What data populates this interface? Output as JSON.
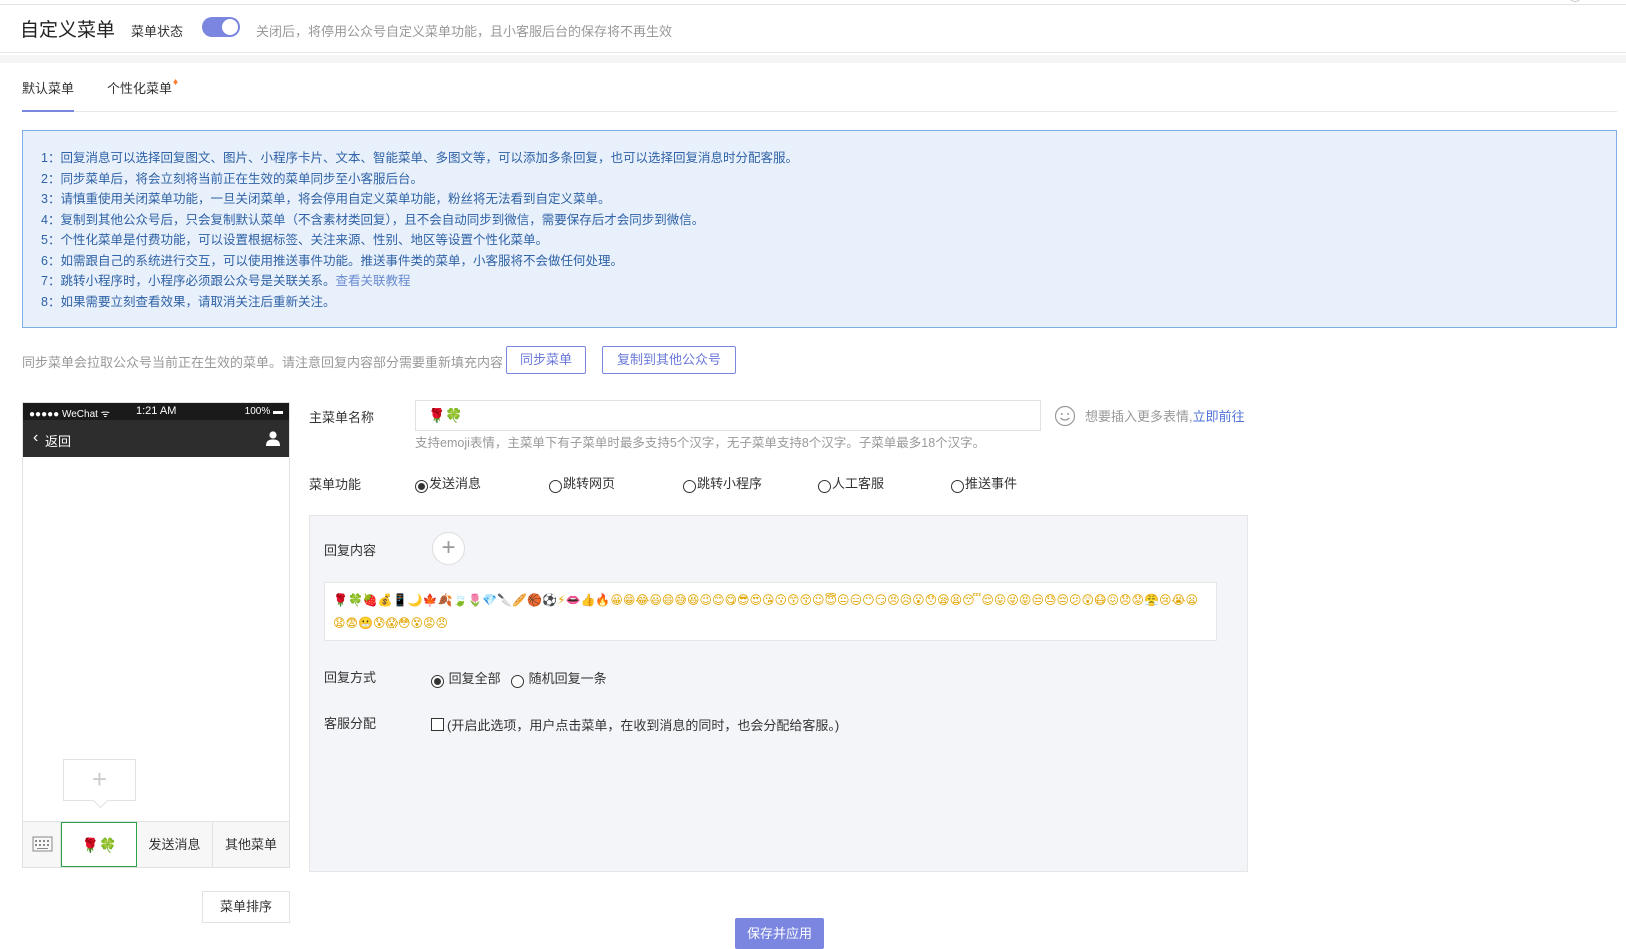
{
  "header": {
    "title": "自定义菜单",
    "status_label": "菜单状态",
    "toggle_on": true,
    "status_hint": "关闭后，将停用公众号自定义菜单功能，且小客服后台的保存将不再生效"
  },
  "tabs": [
    {
      "label": "默认菜单",
      "active": true
    },
    {
      "label": "个性化菜单",
      "active": false,
      "icon": "vip-diamond-icon"
    }
  ],
  "notice": {
    "lines": [
      "1：回复消息可以选择回复图文、图片、小程序卡片、文本、智能菜单、多图文等，可以添加多条回复，也可以选择回复消息时分配客服。",
      "2：同步菜单后，将会立刻将当前正在生效的菜单同步至小客服后台。",
      "3：请慎重使用关闭菜单功能，一旦关闭菜单，将会停用自定义菜单功能，粉丝将无法看到自定义菜单。",
      "4：复制到其他公众号后，只会复制默认菜单（不含素材类回复），且不会自动同步到微信，需要保存后才会同步到微信。",
      "5：个性化菜单是付费功能，可以设置根据标签、关注来源、性别、地区等设置个性化菜单。",
      "6：如需跟自己的系统进行交互，可以使用推送事件功能。推送事件类的菜单，小客服将不会做任何处理。",
      "7：跳转小程序时，小程序必须跟公众号是关联关系。",
      "8：如果需要立刻查看效果，请取消关注后重新关注。"
    ],
    "line7_link": "查看关联教程"
  },
  "sync": {
    "hint": "同步菜单会拉取公众号当前正在生效的菜单。请注意回复内容部分需要重新填充内容",
    "sync_button": "同步菜单",
    "copy_button": "复制到其他公众号"
  },
  "phone": {
    "carrier": "●●●●● WeChat ᯤ",
    "time": "1:21 AM",
    "battery": "100% ▬",
    "back_label": "返回",
    "add_symbol": "+",
    "menu_items": [
      "🌹🍀",
      "发送消息",
      "其他菜单"
    ]
  },
  "sort_button": "菜单排序",
  "form": {
    "name_label": "主菜单名称",
    "name_value": "🌹🍀",
    "emoji_hint": "想要插入更多表情,",
    "emoji_link": "立即前往",
    "name_help": "支持emoji表情，主菜单下有子菜单时最多支持5个汉字，无子菜单支持8个汉字。子菜单最多18个汉字。",
    "function_label": "菜单功能",
    "function_options": [
      "发送消息",
      "跳转网页",
      "跳转小程序",
      "人工客服",
      "推送事件"
    ],
    "function_selected": "发送消息",
    "reply_label": "回复内容",
    "reply_emojis": "🌹🍀🍓💰📱🌙🍁🍂🍃🌷💎🔪🥖🏀⚽⚡👄👍🔥😀😁😂😃😄😅😆😉😊😋😎😍😘😗😙😚☺😇😐😑😶😏😣😥😮😯😪😫😴😌😛😜😝😒😓😔😕😲😷😖😞😟😤😢😭😦😧😨😬😰😱😳😵😡😠",
    "mode_label": "回复方式",
    "mode_options": [
      "回复全部",
      "随机回复一条"
    ],
    "mode_selected": "回复全部",
    "cs_label": "客服分配",
    "cs_checkbox_text": "(开启此选项，用户点击菜单，在收到消息的同时，也会分配给客服。)"
  },
  "save_button": "保存并应用",
  "colors": {
    "accent": "#7a86e0",
    "notice_bg": "#e8f0fb",
    "notice_text": "#2f62a6",
    "link": "#4f72d8",
    "selected_border": "#2aa24a"
  }
}
